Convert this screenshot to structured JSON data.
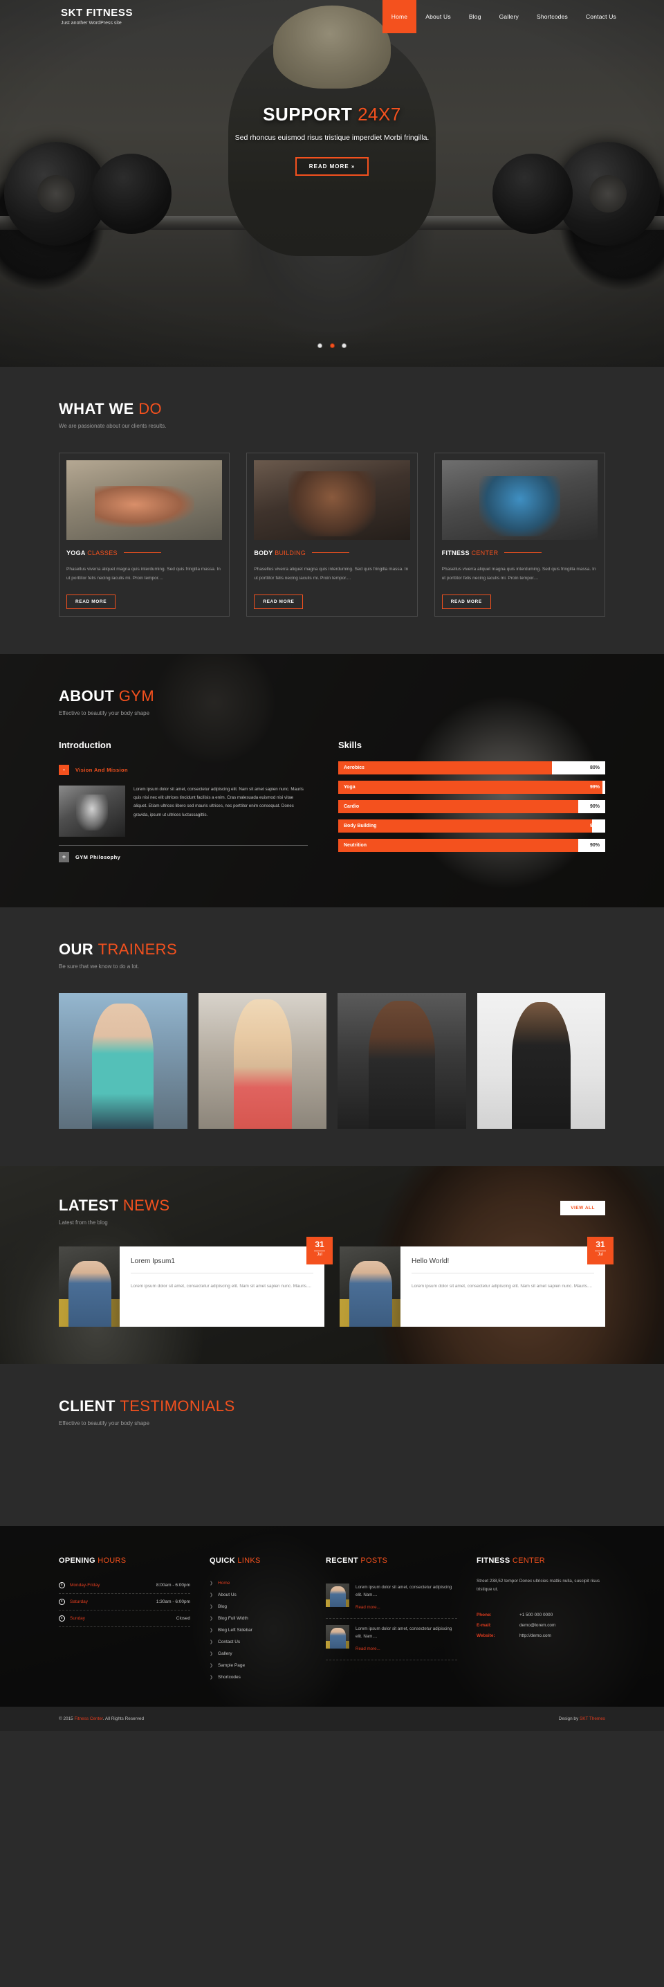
{
  "header": {
    "brand_title": "SKT FITNESS",
    "brand_tagline": "Just another WordPress site",
    "nav": [
      {
        "label": "Home",
        "active": true
      },
      {
        "label": "About Us",
        "active": false
      },
      {
        "label": "Blog",
        "active": false
      },
      {
        "label": "Gallery",
        "active": false
      },
      {
        "label": "Shortcodes",
        "active": false
      },
      {
        "label": "Contact Us",
        "active": false
      }
    ]
  },
  "hero": {
    "title_white": "SUPPORT",
    "title_accent": "24X7",
    "subtitle": "Sed rhoncus euismod risus tristique imperdiet Morbi fringilla.",
    "button": "READ MORE »",
    "slides_total": 3,
    "slide_active": 2
  },
  "what_we_do": {
    "title_white": "WHAT WE",
    "title_accent": "DO",
    "subtitle": "We are passionate about our clients results.",
    "cards": [
      {
        "title_white": "YOGA",
        "title_accent": "CLASSES",
        "desc": "Phasellus viverra aliquet magna quis interduming. Sed quis fringilla massa. In ut porttitor felis necing iaculis mi. Proin tempor....",
        "button": "READ MORE"
      },
      {
        "title_white": "BODY",
        "title_accent": "BUILDING",
        "desc": "Phasellus viverra aliquet magna quis interduming. Sed quis fringilla massa. In ut porttitor felis necing iaculis mi. Proin tempor....",
        "button": "READ MORE"
      },
      {
        "title_white": "FITNESS",
        "title_accent": "CENTER",
        "desc": "Phasellus viverra aliquet magna quis interduming. Sed quis fringilla massa. In ut porttitor felis necing iaculis mi. Proin tempor....",
        "button": "READ MORE"
      }
    ]
  },
  "about": {
    "title_white": "ABOUT",
    "title_accent": "GYM",
    "subtitle": "Effective to beautify your body shape",
    "introduction_heading": "Introduction",
    "accordion": [
      {
        "sign": "-",
        "label": "Vision And Mission",
        "open": true,
        "text": "Lorem ipsum dolor sit amet, consectetur adipiscing elit. Nam sit amet sapien nunc. Mauris quis nisi nec elit ultrices tincidunt facilisis a enim. Cras malesuada euismod nisi vitae aliquet. Etiam ultrices libero sed mauris ultrices, nec porttitor enim consequat. Donec gravida, ipsum ut ultrices luctussagittis."
      },
      {
        "sign": "+",
        "label": "GYM Philosophy",
        "open": false,
        "text": ""
      }
    ],
    "skills_heading": "Skills",
    "skills": [
      {
        "name": "Aerobics",
        "percent": 80,
        "label": "80%"
      },
      {
        "name": "Yoga",
        "percent": 99,
        "label": "99%"
      },
      {
        "name": "Cardio",
        "percent": 90,
        "label": "90%"
      },
      {
        "name": "Body Building",
        "percent": 95,
        "label": "95%"
      },
      {
        "name": "Neutrition",
        "percent": 90,
        "label": "90%"
      }
    ]
  },
  "trainers": {
    "title_white": "OUR",
    "title_accent": "TRAINERS",
    "subtitle": "Be sure that we know to do a lot.",
    "items": [
      {
        "name": "trainer-1"
      },
      {
        "name": "trainer-2"
      },
      {
        "name": "trainer-3"
      },
      {
        "name": "trainer-4"
      }
    ]
  },
  "news": {
    "title_white": "LATEST",
    "title_accent": "NEWS",
    "subtitle": "Latest from the blog",
    "view_all": "VIEW ALL",
    "posts": [
      {
        "title": "Lorem Ipsum1",
        "excerpt": "Lorem ipsum dolor sit amet, consectetur adipiscing elit. Nam sit amet sapien nunc. Mauris....",
        "day": "31",
        "month": "Jul"
      },
      {
        "title": "Hello World!",
        "excerpt": "Lorem ipsum dolor sit amet, consectetur adipiscing elit. Nam sit amet sapien nunc. Mauris....",
        "day": "31",
        "month": "Jul"
      }
    ]
  },
  "testimonials": {
    "title_white": "CLIENT",
    "title_accent": "TESTIMONIALS",
    "subtitle": "Effective to beautify your body shape"
  },
  "footer": {
    "hours": {
      "title_white": "OPENING",
      "title_accent": "HOURS",
      "rows": [
        {
          "day": "Monday-Friday",
          "time": "8:00am - 6:00pm"
        },
        {
          "day": "Saturday",
          "time": "1:30am - 6:00pm"
        },
        {
          "day": "Sunday",
          "time": "Closed"
        }
      ]
    },
    "quick_links": {
      "title_white": "QUICK",
      "title_accent": "LINKS",
      "items": [
        {
          "label": "Home",
          "active": true
        },
        {
          "label": "About Us",
          "active": false
        },
        {
          "label": "Blog",
          "active": false
        },
        {
          "label": "Blog Full Width",
          "active": false
        },
        {
          "label": "Blog Left Sidebar",
          "active": false
        },
        {
          "label": "Contact Us",
          "active": false
        },
        {
          "label": "Gallery",
          "active": false
        },
        {
          "label": "Sample Page",
          "active": false
        },
        {
          "label": "Shortcodes",
          "active": false
        }
      ]
    },
    "recent_posts": {
      "title_white": "RECENT",
      "title_accent": "POSTS",
      "items": [
        {
          "text": "Lorem ipsum dolor sit amet, consectetur adipiscing elit. Nam....",
          "more": "Read more..."
        },
        {
          "text": "Lorem ipsum dolor sit amet, consectetur adipiscing elit. Nam....",
          "more": "Read more..."
        }
      ]
    },
    "contact": {
      "title_white": "FITNESS",
      "title_accent": "CENTER",
      "address": "Street 238,52 tempor Donec ultricies mattis nulla, suscipit risus tristique ut.",
      "rows": [
        {
          "key": "Phone:",
          "value": "+1 500 000 0000"
        },
        {
          "key": "E-mail:",
          "value": "demo@lorem.com"
        },
        {
          "key": "Website:",
          "value": "http://demo.com"
        }
      ]
    },
    "copyright_pre": "© 2015 ",
    "copyright_link": "Fitness Center",
    "copyright_post": ". All Rights Reserved",
    "design_pre": "Design by ",
    "design_link": "SKT Themes"
  },
  "colors": {
    "accent": "#f4511e",
    "bg": "#2b2b2b",
    "footer_bg": "#141413"
  }
}
